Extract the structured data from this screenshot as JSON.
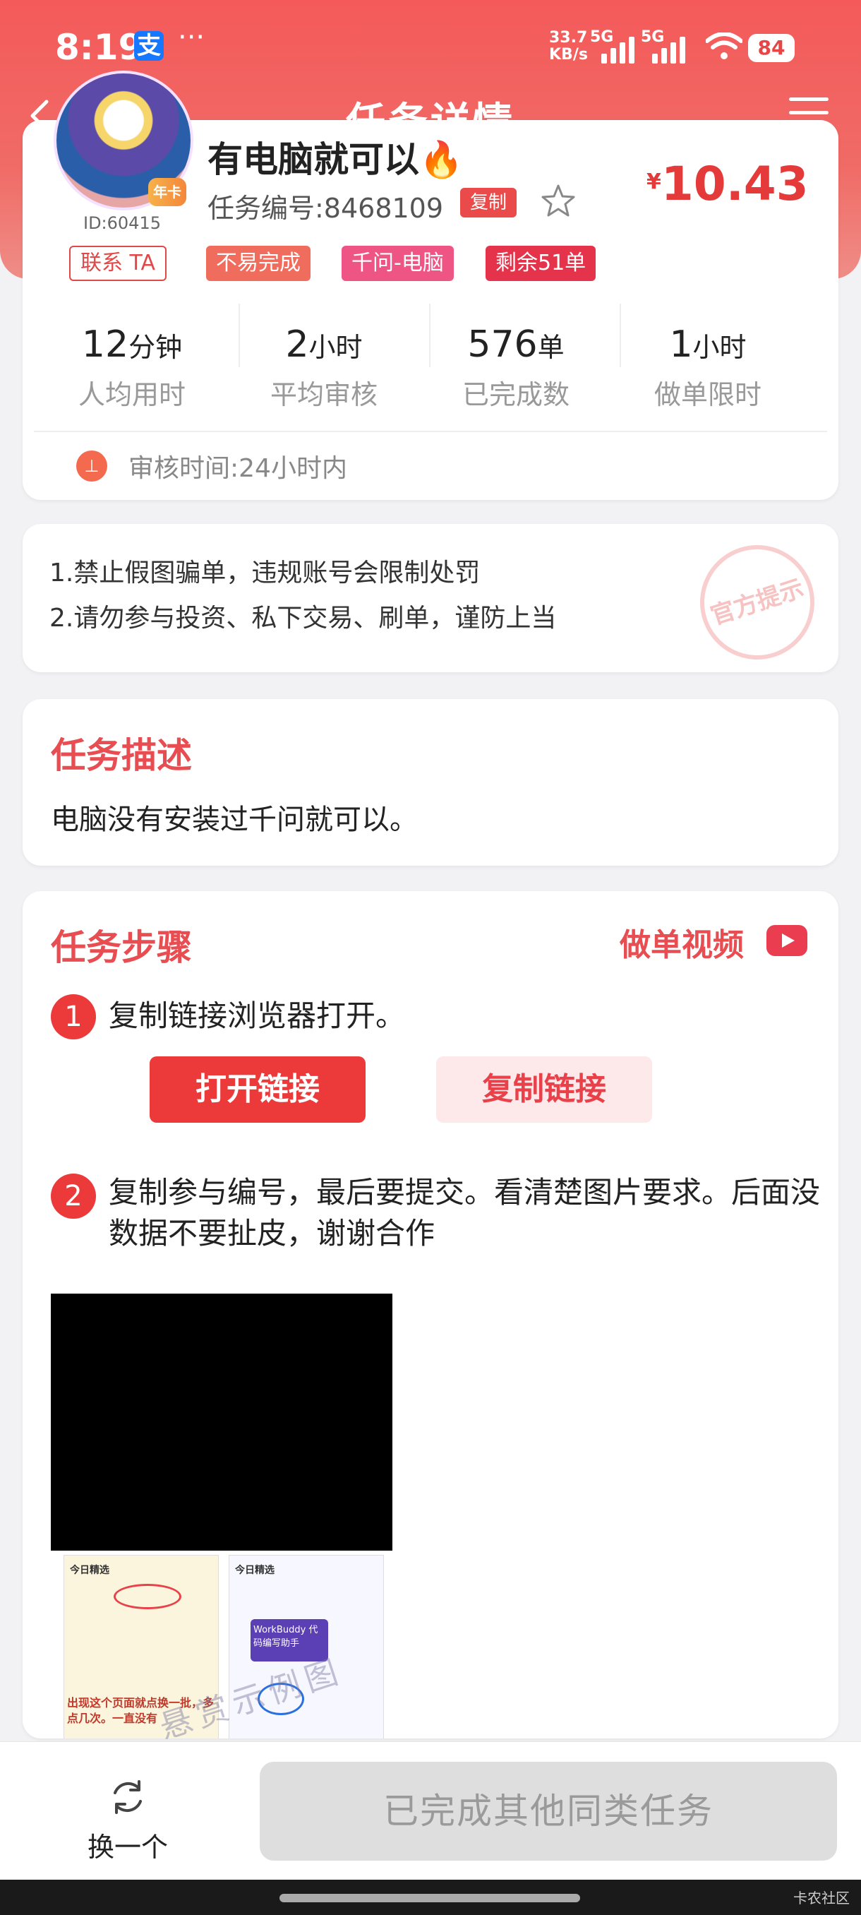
{
  "status_bar": {
    "time": "8:19",
    "alipay_icon": "支",
    "more": "···",
    "net_speed_top": "33.7",
    "net_speed_bottom": "KB/s",
    "sim1": "5G",
    "sim2": "5G",
    "battery": "84"
  },
  "nav": {
    "title": "任务详情"
  },
  "task": {
    "title": "有电脑就可以🔥",
    "vip_badge": "年卡",
    "user_id": "ID:60415",
    "number": "任务编号:8468109",
    "copy_label": "复制",
    "price_currency": "¥",
    "price_value": "10.43",
    "tags": [
      "联系 TA",
      "不易完成",
      "千问-电脑",
      "剩余51单"
    ],
    "stats": [
      {
        "value": "12",
        "unit": "分钟",
        "label": "人均用时"
      },
      {
        "value": "2",
        "unit": "小时",
        "label": "平均审核"
      },
      {
        "value": "576",
        "unit": "单",
        "label": "已完成数"
      },
      {
        "value": "1",
        "unit": "小时",
        "label": "做单限时"
      }
    ],
    "review_time": "审核时间:24小时内"
  },
  "notice": {
    "lines": [
      "1.禁止假图骗单，违规账号会限制处罚",
      "2.请勿参与投资、私下交易、刷单，谨防上当"
    ],
    "stamp": "官方提示"
  },
  "description": {
    "title": "任务描述",
    "text": "电脑没有安装过千问就可以。"
  },
  "steps": {
    "title": "任务步骤",
    "video_link": "做单视频",
    "items": [
      {
        "num": "1",
        "text": "复制链接浏览器打开。"
      },
      {
        "num": "2",
        "text": "复制参与编号，最后要提交。看清楚图片要求。后面没数据不要扯皮，谢谢合作"
      }
    ],
    "open_link": "打开链接",
    "copy_link": "复制链接",
    "thumb1_title": "今日精选",
    "thumb1_bottom": "出现这个页面就点换一批，多点几次。一直没有",
    "thumb2_title": "今日精选",
    "thumb2_box": "WorkBuddy 代码编写助手",
    "watermark": "悬赏示例图"
  },
  "bottom": {
    "switch_label": "换一个",
    "done_label": "已完成其他同类任务",
    "corner_mark": "卡农社区"
  },
  "colors": {
    "accent": "#e84d52",
    "header": "#f45a5a",
    "price": "#e53a3a"
  }
}
